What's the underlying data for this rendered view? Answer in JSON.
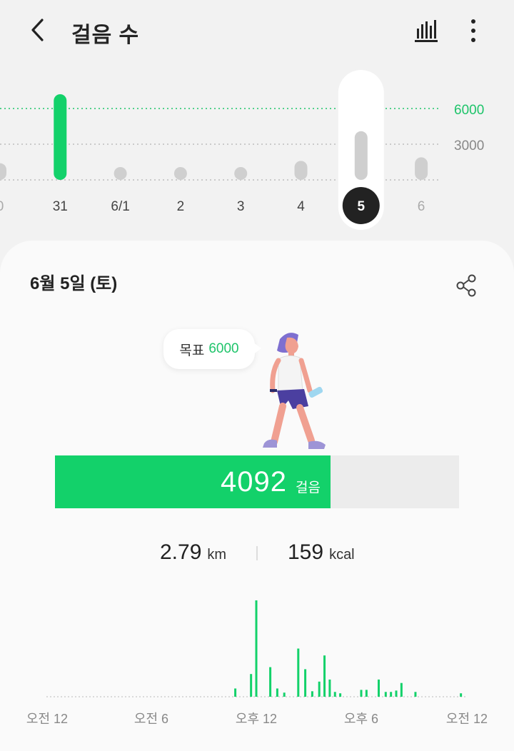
{
  "header": {
    "title": "걸음 수",
    "back_icon": "back-arrow-icon",
    "chart_icon": "bar-chart-icon",
    "more_icon": "more-vert-icon"
  },
  "week_chart": {
    "goal_line_label": "6000",
    "mid_line_label": "3000",
    "goal": 6000,
    "selected_day": "5",
    "days": [
      {
        "label": "0",
        "steps": 1400
      },
      {
        "label": "31",
        "steps": 7800
      },
      {
        "label": "6/1",
        "steps": 250
      },
      {
        "label": "2",
        "steps": 350
      },
      {
        "label": "3",
        "steps": 450
      },
      {
        "label": "4",
        "steps": 1600
      },
      {
        "label": "5",
        "steps": 4092
      },
      {
        "label": "6",
        "steps": 1900
      }
    ]
  },
  "detail": {
    "date": "6월 5일 (토)",
    "share_icon": "share-icon",
    "goal_label": "목표",
    "goal_value": "6000",
    "steps_value": "4092",
    "steps_unit": "걸음",
    "progress": 0.682,
    "distance_value": "2.79",
    "distance_unit": "km",
    "calories_value": "159",
    "calories_unit": "kcal"
  },
  "colors": {
    "accent": "#13d16a",
    "accent_text": "#1ec46a",
    "bar_inactive": "#cfcfcf",
    "selected_badge": "#222222"
  },
  "chart_data": {
    "type": "bar",
    "title": "",
    "xlabel": "",
    "ylabel": "",
    "x_ticks": [
      "오전 12",
      "오전 6",
      "오후 12",
      "오후 6",
      "오전 12"
    ],
    "x_range": [
      0,
      24
    ],
    "grid": false,
    "series": [
      {
        "x": [
          10.8,
          11.7,
          12.0,
          12.8,
          13.2,
          13.6,
          14.4,
          14.8,
          15.2,
          15.6,
          15.9,
          16.2,
          16.5,
          16.8,
          18.0,
          18.3,
          19.0,
          19.4,
          19.7,
          20.0,
          20.3,
          21.1,
          23.7
        ],
        "values": [
          12,
          33,
          140,
          43,
          12,
          6,
          70,
          40,
          8,
          22,
          60,
          25,
          7,
          5,
          10,
          10,
          25,
          7,
          7,
          9,
          20,
          7,
          5
        ]
      }
    ]
  }
}
